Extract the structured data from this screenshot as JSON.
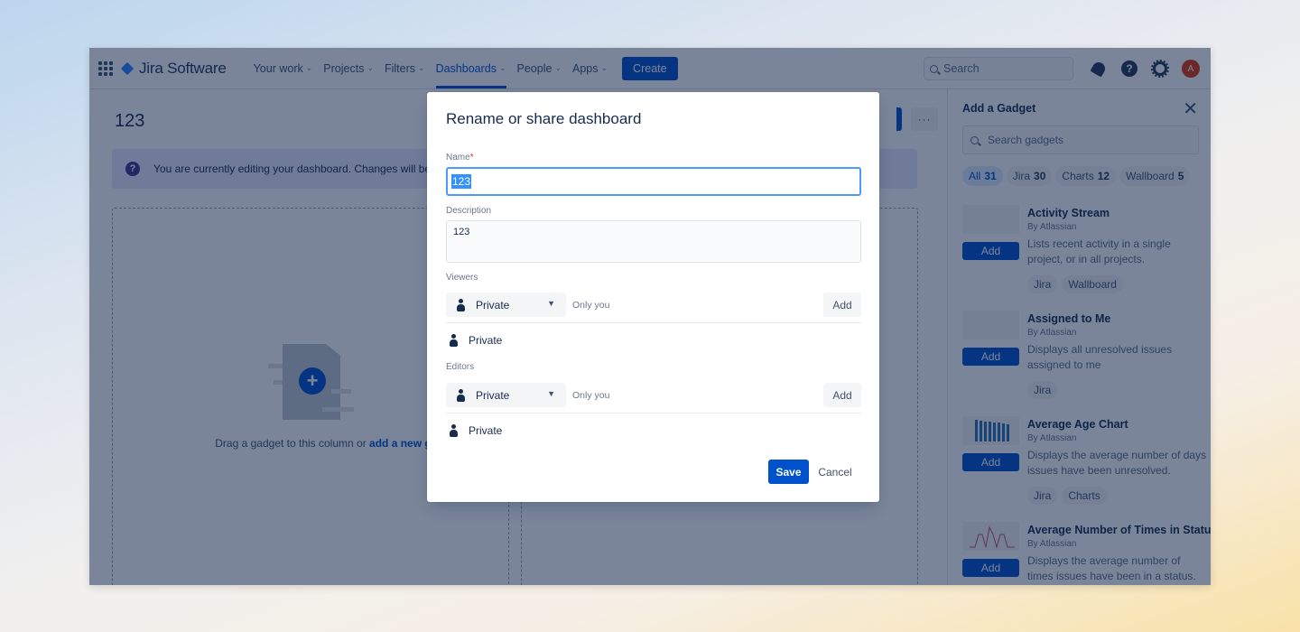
{
  "topnav": {
    "app_name": "Jira Software",
    "items": [
      {
        "label": "Your work",
        "active": false
      },
      {
        "label": "Projects",
        "active": false
      },
      {
        "label": "Filters",
        "active": false
      },
      {
        "label": "Dashboards",
        "active": true
      },
      {
        "label": "People",
        "active": false
      },
      {
        "label": "Apps",
        "active": false
      }
    ],
    "create_label": "Create",
    "search_placeholder": "Search",
    "avatar_initial": "A"
  },
  "dashboard": {
    "title": "123",
    "more_label": "···",
    "banner_text": "You are currently editing your dashboard. Changes will be s",
    "empty_text": "Drag a gadget to this column or ",
    "empty_link": "add a new gadget"
  },
  "gadget_panel": {
    "title": "Add a Gadget",
    "close_label": "✕",
    "search_placeholder": "Search gadgets",
    "filters": [
      {
        "label": "All",
        "count": "31",
        "active": true
      },
      {
        "label": "Jira",
        "count": "30",
        "active": false
      },
      {
        "label": "Charts",
        "count": "12",
        "active": false
      },
      {
        "label": "Wallboard",
        "count": "5",
        "active": false
      }
    ],
    "add_label": "Add",
    "gadgets": [
      {
        "name": "Activity Stream",
        "by": "By Atlassian",
        "description": "Lists recent activity in a single project, or in all projects.",
        "tags": [
          "Jira",
          "Wallboard"
        ]
      },
      {
        "name": "Assigned to Me",
        "by": "By Atlassian",
        "description": "Displays all unresolved issues assigned to me",
        "tags": [
          "Jira"
        ]
      },
      {
        "name": "Average Age Chart",
        "by": "By Atlassian",
        "description": "Displays the average number of days issues have been unresolved.",
        "tags": [
          "Jira",
          "Charts"
        ]
      },
      {
        "name": "Average Number of Times in Status",
        "by": "By Atlassian",
        "description": "Displays the average number of times issues have been in a status.",
        "tags": []
      }
    ]
  },
  "modal": {
    "title": "Rename or share dashboard",
    "name_label": "Name",
    "required_mark": "*",
    "name_value": "123",
    "description_label": "Description",
    "description_value": "123",
    "viewers": {
      "label": "Viewers",
      "select_value": "Private",
      "hint": "Only you",
      "add_label": "Add",
      "items": [
        "Private"
      ]
    },
    "editors": {
      "label": "Editors",
      "select_value": "Private",
      "hint": "Only you",
      "add_label": "Add",
      "items": [
        "Private"
      ]
    },
    "save_label": "Save",
    "cancel_label": "Cancel"
  }
}
